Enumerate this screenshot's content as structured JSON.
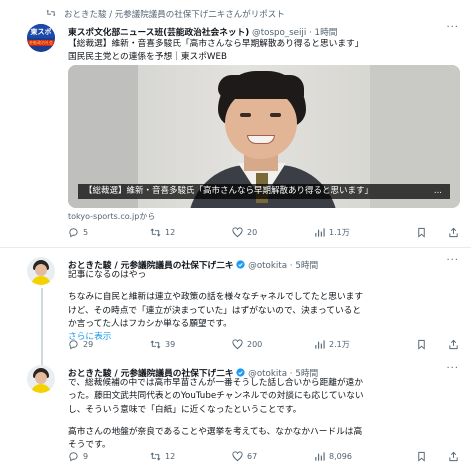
{
  "tweet1": {
    "repost_line": "おときた駿 / 元参議院議員の社保下げ二キさんがリポスト",
    "name": "東スポ文化部ニュース班(芸能政治社会ネット)",
    "handle": "@tospo_seiji · 1時間",
    "text_line1": "【総裁選】維新・音喜多駿氏「高市さんなら早期解散あり得ると思います」",
    "text_line2": "国民民主党との連係を予想｜東スポWEB",
    "media_caption": "【総裁選】維新・音喜多駿氏「高市さんなら早期解散あり得ると思います」",
    "caption_ellipsis": "...",
    "link_source": "tokyo-sports.co.jpから",
    "avatar_text_top": "東スポ",
    "avatar_text_bottom": "芸能政治社会",
    "metrics": {
      "replies": "5",
      "reposts": "12",
      "likes": "20",
      "views": "1.1万"
    }
  },
  "tweet2": {
    "name": "おときた駿 / 元参議院議員の社保下げ二キ",
    "handle": "@otokita · 5時間",
    "line1": "記事になるのはやっ",
    "line2": "ちなみに自民と維新は連立や政策の話を様々なチャネルでしてたと思います",
    "line3": "けど、その時点で「連立が決まっていた」はずがないので、決まっていると",
    "line4": "か言ってた人はフカシか単なる願望です。",
    "show_more": "さらに表示",
    "metrics": {
      "replies": "29",
      "reposts": "39",
      "likes": "200",
      "views": "2.1万"
    }
  },
  "tweet3": {
    "name": "おときた駿 / 元参議院議員の社保下げ二キ",
    "handle": "@otokita · 5時間",
    "line1": "で、総裁候補の中では高市早苗さんが一番そうした話し合いから距離が遠か",
    "line2": "った。藤田文武共同代表とのYouTubeチャンネルでの対談にも応じていない",
    "line3": "し、そういう意味で「白紙」に近くなったということです。",
    "line4": "高市さんの地盤が奈良であることや選挙を考えても、なかなかハードルは高",
    "line5": "そうです。",
    "metrics": {
      "replies": "9",
      "reposts": "12",
      "likes": "67",
      "views": "8,096"
    }
  },
  "colors": {
    "accent": "#1d9bf0",
    "muted": "#536471",
    "text": "#0f1419",
    "repost_green": "#00ba7c"
  }
}
